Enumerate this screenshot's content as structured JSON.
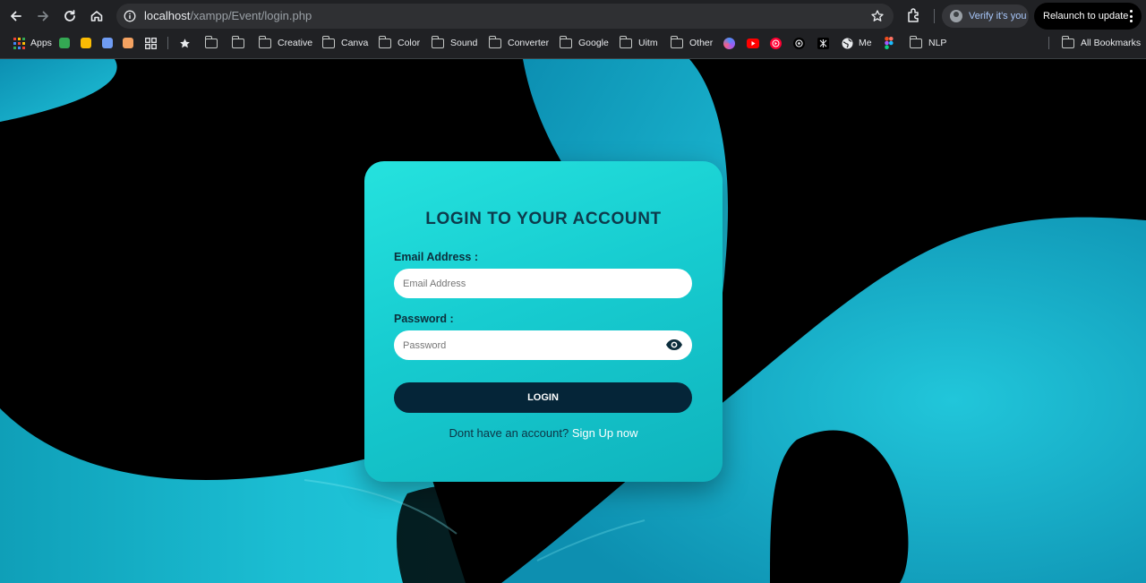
{
  "browser": {
    "url_host": "localhost",
    "url_path": "/xampp/Event/login.php",
    "profile_label": "Verify it's you",
    "relaunch_label": "Relaunch to update",
    "nav_icons": [
      "back-arrow-icon",
      "forward-arrow-icon",
      "reload-icon",
      "home-icon"
    ]
  },
  "bookmarks": {
    "apps_label": "Apps",
    "items": [
      {
        "label": "Creative",
        "icon": "folder-icon"
      },
      {
        "label": "Canva",
        "icon": "folder-icon"
      },
      {
        "label": "Color",
        "icon": "folder-icon"
      },
      {
        "label": "Sound",
        "icon": "folder-icon"
      },
      {
        "label": "Converter",
        "icon": "folder-icon"
      },
      {
        "label": "Google",
        "icon": "folder-icon"
      },
      {
        "label": "Uitm",
        "icon": "folder-icon"
      },
      {
        "label": "Other",
        "icon": "folder-icon"
      },
      {
        "label": "Me",
        "icon": "globe-icon"
      },
      {
        "label": "NLP",
        "icon": "folder-icon"
      }
    ],
    "all_bookmarks_label": "All Bookmarks"
  },
  "login": {
    "title": "LOGIN TO YOUR ACCOUNT",
    "email_label": "Email Address :",
    "email_placeholder": "Email Address",
    "password_label": "Password :",
    "password_placeholder": "Password",
    "button_label": "LOGIN",
    "signup_prompt": "Dont have an account?",
    "signup_link": "Sign Up now"
  },
  "colors": {
    "card_gradient_start": "#25e2de",
    "card_gradient_end": "#0fb3bd",
    "button": "#052538",
    "background": "#000000",
    "shape_cyan": "#18b9cf"
  }
}
